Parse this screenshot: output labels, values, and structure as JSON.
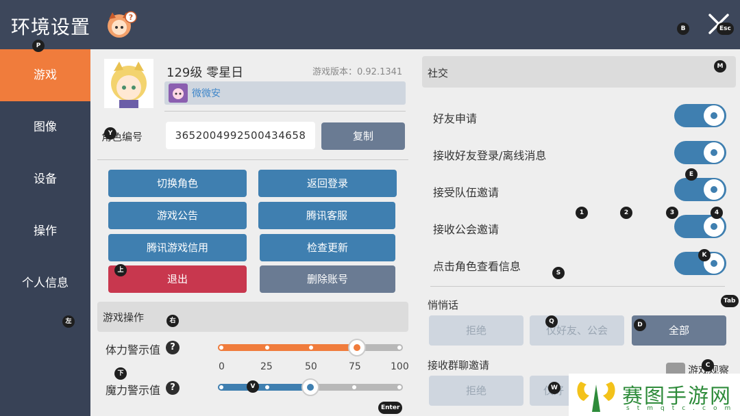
{
  "header": {
    "title": "环境设置",
    "close_hint": "Esc"
  },
  "sidebar": {
    "items": [
      {
        "label": "游戏",
        "active": true
      },
      {
        "label": "图像",
        "active": false
      },
      {
        "label": "设备",
        "active": false
      },
      {
        "label": "操作",
        "active": false
      },
      {
        "label": "个人信息",
        "active": false
      }
    ]
  },
  "profile": {
    "level_name": "129级 零星日",
    "version": "游戏版本：0.92.1341",
    "friend_name": "微微安",
    "role_id_label": "角色编号",
    "role_id_value": "3652004992500434658",
    "copy_label": "复制"
  },
  "actions": {
    "switch_role": "切换角色",
    "back_login": "返回登录",
    "announcement": "游戏公告",
    "tencent_service": "腾讯客服",
    "credit": "腾讯游戏信用",
    "check_update": "检查更新",
    "exit": "退出",
    "delete_account": "删除账号"
  },
  "game_ops": {
    "title": "游戏操作",
    "stamina_label": "体力警示值",
    "stamina_value": 75,
    "mana_label": "魔力警示值",
    "mana_value": 50,
    "ticks": [
      "0",
      "25",
      "50",
      "75",
      "100"
    ],
    "help": "?"
  },
  "social": {
    "title": "社交",
    "toggles": [
      {
        "label": "好友申请",
        "on": true
      },
      {
        "label": "接收好友登录/离线消息",
        "on": true
      },
      {
        "label": "接受队伍邀请",
        "on": true
      },
      {
        "label": "接收公会邀请",
        "on": true
      },
      {
        "label": "点击角色查看信息",
        "on": true
      }
    ],
    "whisper_title": "悄悄话",
    "whisper_options": [
      "拒绝",
      "仅好友、公会",
      "全部"
    ],
    "whisper_selected": "全部",
    "group_title": "接收群聊邀请",
    "group_options": [
      "拒绝",
      "仅好"
    ],
    "tail_text": "游戏观察"
  },
  "key_hints": {
    "p": "P",
    "b": "B",
    "esc": "Esc",
    "y": "Y",
    "m": "M",
    "e": "E",
    "one": "1",
    "two": "2",
    "three": "3",
    "four": "4",
    "k": "K",
    "s": "S",
    "up": "上",
    "left": "左",
    "right": "右",
    "down": "下",
    "v": "V",
    "enter": "Enter",
    "tab": "Tab",
    "q": "Q",
    "d": "D",
    "c": "C",
    "w": "W"
  },
  "watermark": {
    "text": "赛图手游网",
    "sub": "stmqtc.com"
  },
  "colors": {
    "accent": "#f07c3c",
    "blue": "#3f7fb0",
    "red": "#c8374e",
    "header": "#3d475b"
  }
}
